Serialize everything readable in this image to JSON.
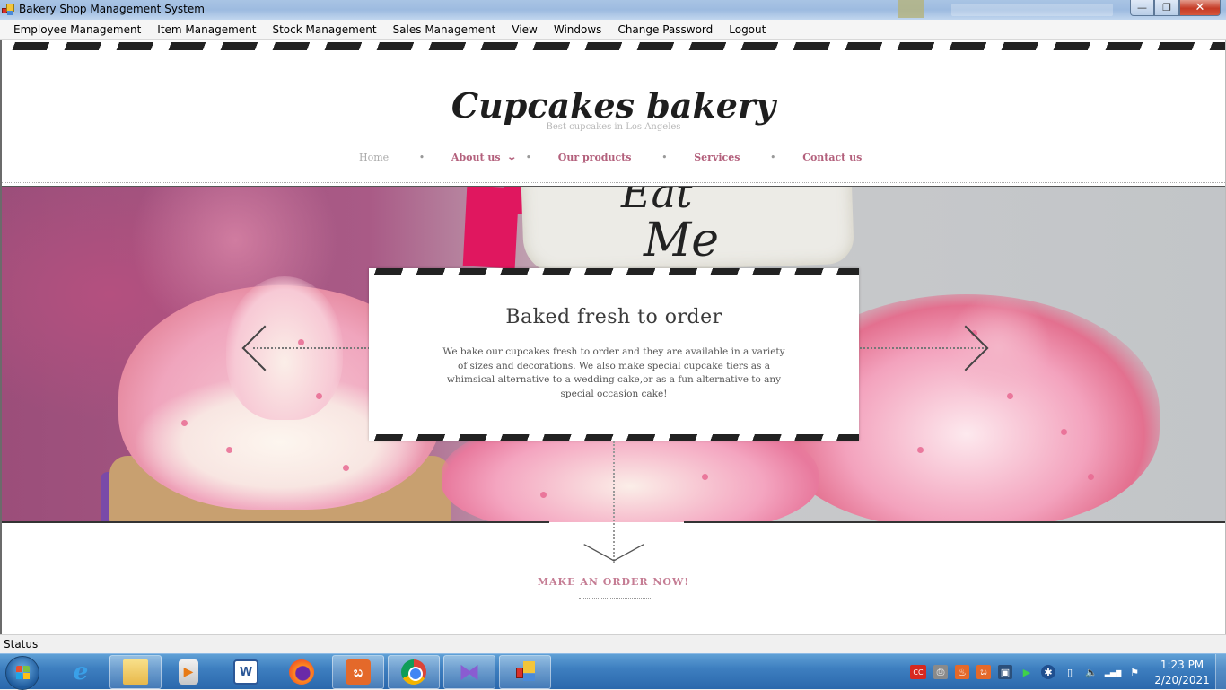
{
  "window": {
    "title": "Bakery Shop Management System",
    "controls": {
      "minimize": "—",
      "restore": "❐",
      "close": "✕"
    }
  },
  "menubar": {
    "items": [
      "Employee Management",
      "Item Management",
      "Stock Management",
      "Sales Management",
      "View",
      "Windows",
      "Change Password",
      "Logout"
    ]
  },
  "website": {
    "logo": "Cupcakes bakery",
    "tagline": "Best cupcakes in Los Angeles",
    "nav": {
      "home": "Home",
      "about": "About us",
      "about_chevron": "⌄",
      "products": "Our products",
      "services": "Services",
      "contact": "Contact us",
      "separator": "•"
    },
    "hero": {
      "tag_line1": "Eat",
      "tag_line2": "Me",
      "slide_title": "Baked fresh to order",
      "slide_text": "We bake our cupcakes fresh to order and they are available in a variety of sizes and decorations. We also make special cupcake tiers as a whimsical alternative to a wedding cake,or as a fun alternative to any special occasion cake!"
    },
    "cta": "MAKE AN ORDER NOW!"
  },
  "statusbar": {
    "text": "Status"
  },
  "taskbar": {
    "pinned": [
      "Internet Explorer",
      "Windows Explorer",
      "Windows Media Player",
      "Microsoft Word",
      "Firefox",
      "XAMPP",
      "Google Chrome",
      "Visual Studio",
      "Bakery Shop Management System"
    ],
    "glyphs": {
      "ie": "e",
      "word": "W",
      "xampp": "ಬ",
      "vs": "⧓",
      "media": "▶"
    },
    "tray": {
      "cc": "CC",
      "printer": "⎙",
      "java": "♨",
      "xampp": "ಬ",
      "network_pc": "▣",
      "sync": "▶",
      "bluetooth": "✱",
      "battery": "▯",
      "volume": "🔈",
      "signal": "▂▄▆",
      "flag": "⚑"
    },
    "clock": {
      "time": "1:23 PM",
      "date": "2/20/2021"
    }
  },
  "colors": {
    "accent_link": "#b3607c",
    "cta": "#c57d94",
    "close_button": "#c53b26"
  }
}
